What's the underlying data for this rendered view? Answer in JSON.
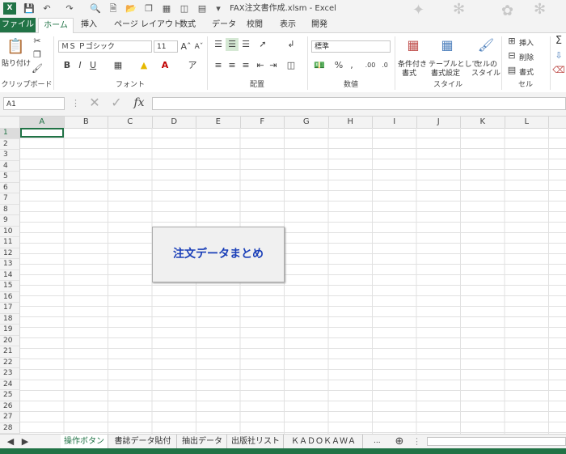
{
  "window": {
    "title": "FAX注文書作成.xlsm - Excel"
  },
  "tabs": {
    "file": "ファイル",
    "home": "ホーム",
    "insert": "挿入",
    "page_layout": "ページ レイアウト",
    "formulas": "数式",
    "data": "データ",
    "review": "校閲",
    "view": "表示",
    "developer": "開発"
  },
  "ribbon": {
    "clipboard": {
      "paste": "貼り付け",
      "label": "クリップボード"
    },
    "font": {
      "name": "ＭＳ Ｐゴシック",
      "size": "11",
      "label": "フォント",
      "bold": "B",
      "italic": "I",
      "underline": "U"
    },
    "alignment": {
      "label": "配置"
    },
    "number": {
      "format": "標準",
      "percent": "%",
      "comma": ",",
      "label": "数値"
    },
    "styles": {
      "conditional": "条件付き",
      "conditional2": "書式",
      "table": "テーブルとして",
      "table2": "書式設定",
      "cell": "セルの",
      "cell2": "スタイル",
      "label": "スタイル"
    },
    "cells": {
      "insert": "挿入",
      "delete": "削除",
      "format": "書式",
      "label": "セル"
    }
  },
  "formula_bar": {
    "name_box": "A1",
    "fx": "fx",
    "value": ""
  },
  "columns": [
    "A",
    "B",
    "C",
    "D",
    "E",
    "F",
    "G",
    "H",
    "I",
    "J",
    "K",
    "L"
  ],
  "rows": [
    "1",
    "2",
    "3",
    "4",
    "5",
    "6",
    "7",
    "8",
    "9",
    "10",
    "11",
    "12",
    "13",
    "14",
    "15",
    "16",
    "17",
    "18",
    "19",
    "20",
    "21",
    "22",
    "23",
    "24",
    "25",
    "26",
    "27",
    "28"
  ],
  "button": {
    "label": "注文データまとめ"
  },
  "sheet_tabs": [
    "操作ボタン",
    "書誌データ貼付",
    "抽出データ",
    "出版社リスト",
    "ＫＡＤＯＫＡＷＡ"
  ],
  "sheet_more": "...",
  "colors": {
    "accent": "#217346",
    "button_text": "#1a3fb8"
  }
}
